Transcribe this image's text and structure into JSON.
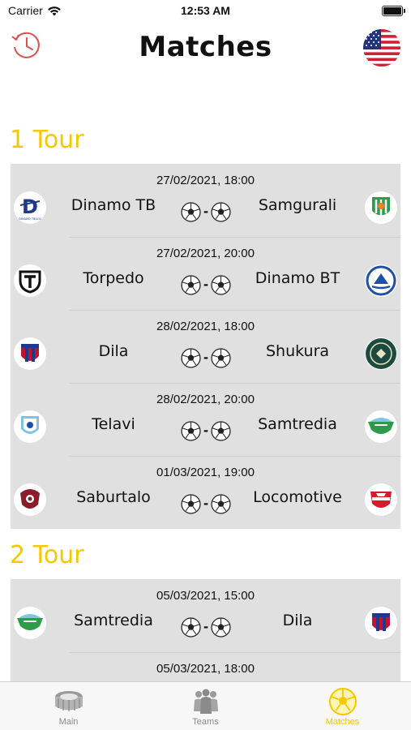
{
  "status_bar": {
    "carrier": "Carrier",
    "time": "12:53 AM"
  },
  "header": {
    "title": "Matches",
    "left_icon": "history-icon",
    "right_icon": "us-flag-icon"
  },
  "colors": {
    "accent": "#f5c800",
    "card_bg": "#e0e0e0",
    "history_icon": "#d9534f"
  },
  "tours": [
    {
      "title": "1 Tour",
      "matches": [
        {
          "date": "27/02/2021, 18:00",
          "home": "Dinamo TB",
          "away": "Samgurali"
        },
        {
          "date": "27/02/2021, 20:00",
          "home": "Torpedo",
          "away": "Dinamo BT"
        },
        {
          "date": "28/02/2021, 18:00",
          "home": "Dila",
          "away": "Shukura"
        },
        {
          "date": "28/02/2021, 20:00",
          "home": "Telavi",
          "away": "Samtredia"
        },
        {
          "date": "01/03/2021, 19:00",
          "home": "Saburtalo",
          "away": "Locomotive"
        }
      ]
    },
    {
      "title": "2 Tour",
      "matches": [
        {
          "date": "05/03/2021, 15:00",
          "home": "Samtredia",
          "away": "Dila"
        },
        {
          "date": "05/03/2021, 18:00",
          "home": "",
          "away": ""
        }
      ]
    }
  ],
  "score_separator": "-",
  "tabs": [
    {
      "label": "Main",
      "icon": "stadium-icon",
      "active": false
    },
    {
      "label": "Teams",
      "icon": "team-icon",
      "active": false
    },
    {
      "label": "Matches",
      "icon": "football-icon",
      "active": true
    }
  ]
}
